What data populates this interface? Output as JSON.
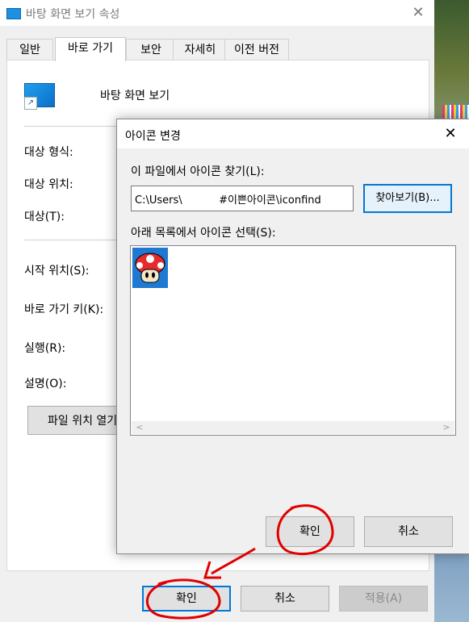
{
  "props_window": {
    "title": "바탕 화면 보기 속성",
    "tabs": [
      "일반",
      "바로 가기",
      "보안",
      "자세히",
      "이전 버전"
    ],
    "active_tab": "바로 가기",
    "shortcut_name": "바탕 화면 보기",
    "fields": {
      "target_type": "대상 형식:",
      "target_location": "대상 위치:",
      "target": "대상(T):",
      "start_in": "시작 위치(S):",
      "shortcut_key": "바로 가기 키(K):",
      "run": "실행(R):",
      "comment": "설명(O):"
    },
    "open_location_label": "파일 위치 열기",
    "buttons": {
      "ok": "확인",
      "cancel": "취소",
      "apply": "적용(A)"
    }
  },
  "change_icon_dialog": {
    "title": "아이콘 변경",
    "search_label": "이 파일에서 아이콘 찾기(L):",
    "path_value": "C:\\Users\\           #이쁜아이콘\\iconfind",
    "browse_label": "찾아보기(B)...",
    "list_label": "아래 목록에서 아이콘 선택(S):",
    "icons": [
      "mushroom-icon"
    ],
    "buttons": {
      "ok": "확인",
      "cancel": "취소"
    }
  },
  "colors": {
    "accent": "#0078d7",
    "annotation": "#e00000",
    "selection": "#1f78d1"
  }
}
